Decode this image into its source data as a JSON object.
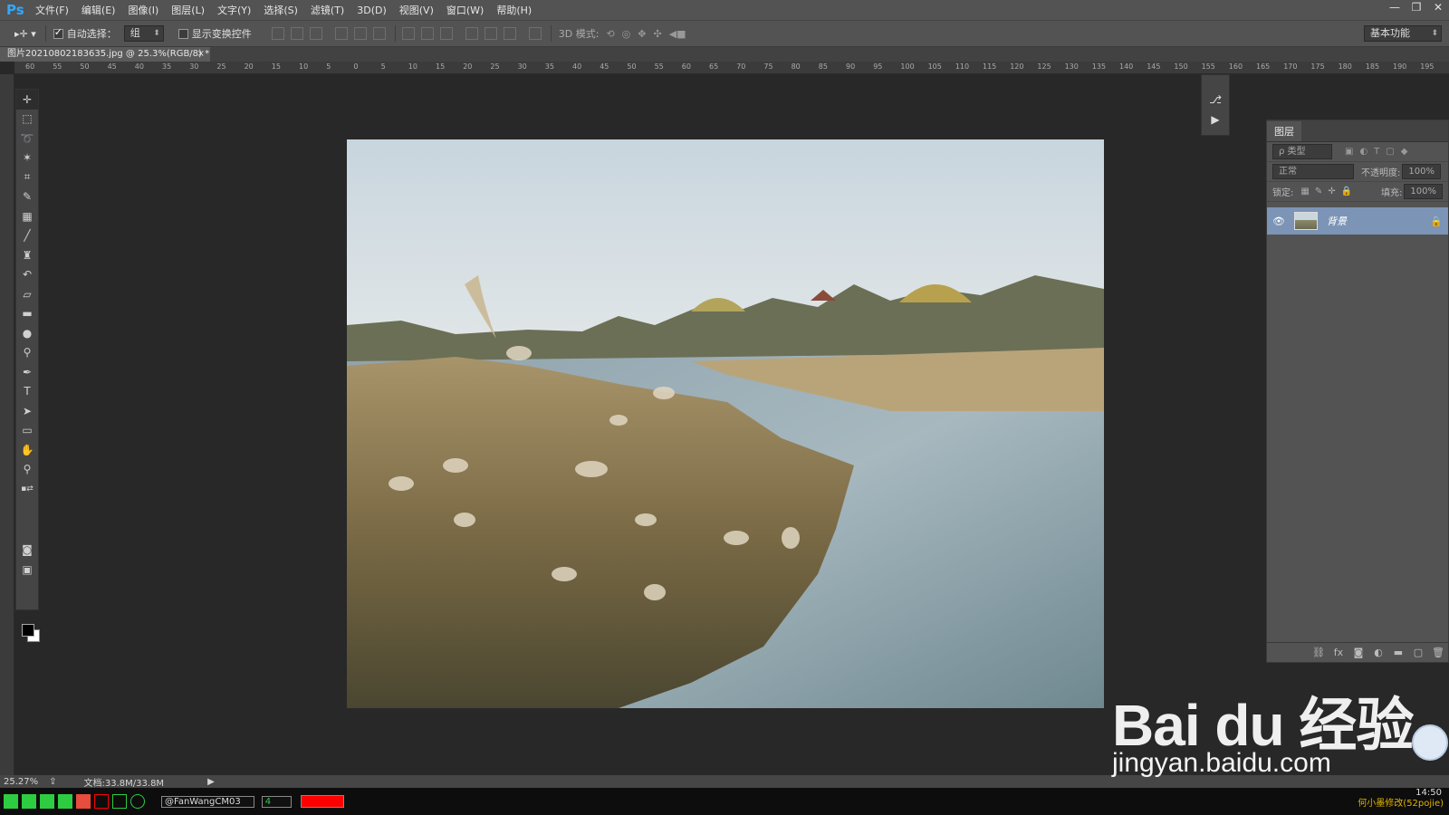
{
  "app": {
    "logo": "Ps"
  },
  "menu": [
    "文件(F)",
    "编辑(E)",
    "图像(I)",
    "图层(L)",
    "文字(Y)",
    "选择(S)",
    "滤镜(T)",
    "3D(D)",
    "视图(V)",
    "窗口(W)",
    "帮助(H)"
  ],
  "options": {
    "auto_select_label": "自动选择：",
    "auto_select_value": "组",
    "show_transform_label": "显示变换控件",
    "mode_3d_label": "3D 模式:",
    "workspace": "基本功能"
  },
  "document": {
    "tab_title": "图片20210802183635.jpg @ 25.3%(RGB/8) *",
    "close": "×"
  },
  "ruler_ticks": [
    "60",
    "55",
    "50",
    "45",
    "40",
    "35",
    "30",
    "25",
    "20",
    "15",
    "10",
    "5",
    "0",
    "5",
    "10",
    "15",
    "20",
    "25",
    "30",
    "35",
    "40",
    "45",
    "50",
    "55",
    "60",
    "65",
    "70",
    "75",
    "80",
    "85",
    "90",
    "95",
    "100",
    "105",
    "110",
    "115",
    "120",
    "125",
    "130",
    "135",
    "140",
    "145",
    "150",
    "155",
    "160",
    "165",
    "170",
    "175",
    "180",
    "185",
    "190",
    "195"
  ],
  "layers_panel": {
    "title": "图层",
    "filter_kind": "ρ 类型",
    "blend_mode": "正常",
    "opacity_label": "不透明度:",
    "opacity_value": "100%",
    "lock_label": "锁定:",
    "fill_label": "填充:",
    "fill_value": "100%",
    "layer_name": "背景"
  },
  "status": {
    "zoom": "25.27%",
    "doc_size": "文档:33.8M/33.8M"
  },
  "taskbar": {
    "font_field": "@FanWangCM03",
    "size_field": "4",
    "clock": "14:50",
    "right_text": "何小墨修改(52pojie)"
  },
  "watermark": {
    "brand": "Bai du 经验",
    "url": "jingyan.baidu.com"
  },
  "colors": {
    "accent": "#31a8ff",
    "layer_selected": "#7c94b5",
    "panel_bg": "#535353",
    "workspace_bg": "#282828"
  }
}
